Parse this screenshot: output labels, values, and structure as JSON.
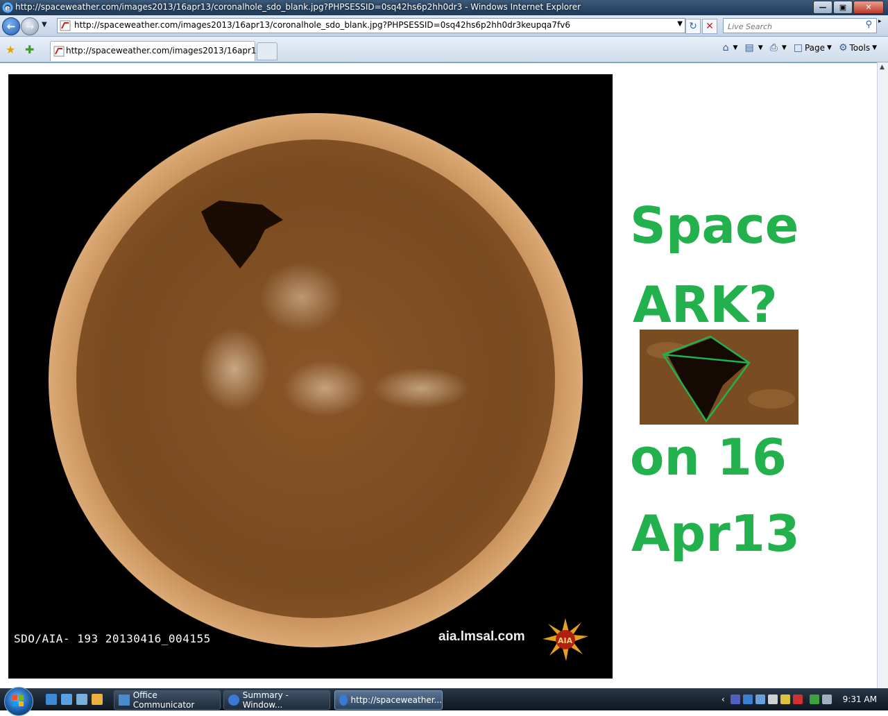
{
  "window": {
    "title": "http://spaceweather.com/images2013/16apr13/coronalhole_sdo_blank.jpg?PHPSESSID=0sq42hs6p2hh0dr3 - Windows Internet Explorer"
  },
  "address": {
    "url": "http://spaceweather.com/images2013/16apr13/coronalhole_sdo_blank.jpg?PHPSESSID=0sq42hs6p2hh0dr3keupqa7fv6"
  },
  "search": {
    "placeholder": "Live Search"
  },
  "tab": {
    "label": "http://spaceweather.com/images2013/16apr13/c..."
  },
  "commandbar": {
    "page_label": "Page",
    "tools_label": "Tools"
  },
  "image": {
    "sdo_label": "SDO/AIA- 193 20130416_004155",
    "aia_label": "aia.lmsal.com",
    "aia_logo_text": "AIA"
  },
  "caption": {
    "line1": "Space",
    "line2": "ARK?",
    "line3": "on 16",
    "line4": "Apr13",
    "color": "#22b14c"
  },
  "taskbar": {
    "buttons": [
      {
        "label": "Office Communicator"
      },
      {
        "label": "Summary - Window..."
      },
      {
        "label": "http://spaceweather..."
      }
    ],
    "clock": "9:31 AM"
  }
}
